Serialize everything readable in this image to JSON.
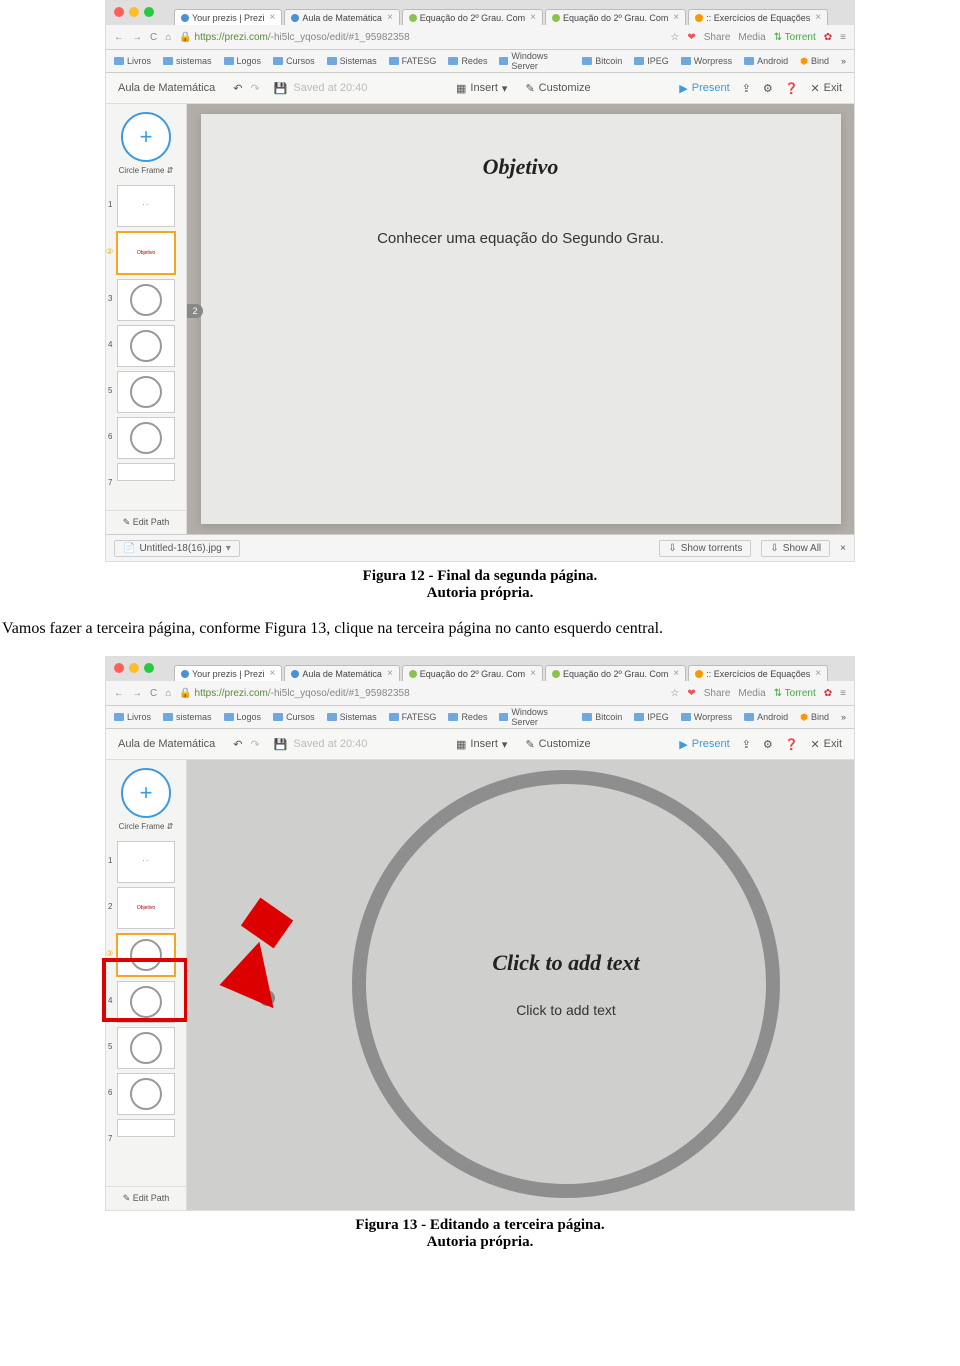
{
  "tabs": [
    {
      "label": "Your prezis | Prezi"
    },
    {
      "label": "Aula de Matemática"
    },
    {
      "label": "Equação do 2º Grau. Com"
    },
    {
      "label": "Equação do 2º Grau. Com"
    },
    {
      "label": ":: Exercícios de Equações"
    }
  ],
  "url_host": "https://prezi.com",
  "url_path": "/-hi5lc_yqoso/edit/#1_95982358",
  "ext": {
    "share": "Share",
    "media": "Media",
    "torrent": "Torrent"
  },
  "bookmarks": [
    "Livros",
    "sistemas",
    "Logos",
    "Cursos",
    "Sistemas",
    "FATESG",
    "Redes",
    "Windows Server",
    "Bitcoin",
    "IPEG",
    "Worpress",
    "Android",
    "Bind"
  ],
  "app": {
    "title": "Aula de Matemática",
    "saved": "Saved at 20:40",
    "insert": "Insert",
    "customize": "Customize",
    "present": "Present",
    "exit": "Exit",
    "circle_frame": "Circle Frame",
    "edit_path": "Edit Path"
  },
  "slide1": {
    "title": "Objetivo",
    "body": "Conhecer uma equação do Segundo Grau."
  },
  "download": {
    "file": "Untitled-18(16).jpg",
    "show_torrents": "Show torrents",
    "show_all": "Show All"
  },
  "fig12": {
    "title": "Figura 12 - Final da segunda página.",
    "author": "Autoria própria."
  },
  "para": "Vamos fazer a terceira página, conforme Figura 13, clique na terceira página no canto esquerdo central.",
  "slide2": {
    "t1": "Click to add text",
    "t2": "Click to add text"
  },
  "fig13": {
    "title": "Figura 13 - Editando a terceira página.",
    "author": "Autoria própria."
  }
}
